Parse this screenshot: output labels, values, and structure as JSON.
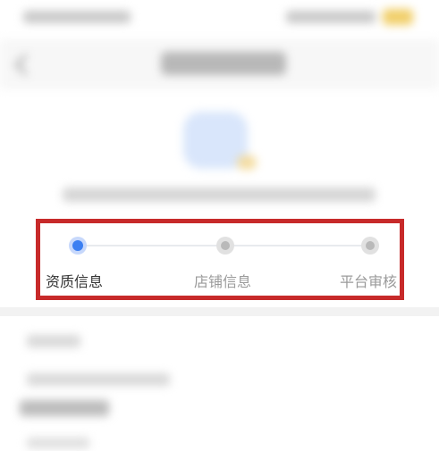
{
  "steps": [
    {
      "label": "资质信息",
      "state": "active"
    },
    {
      "label": "店铺信息",
      "state": "pending"
    },
    {
      "label": "平台审核",
      "state": "pending"
    }
  ],
  "colors": {
    "active_step": "#3b7ff2",
    "pending_step": "#b9b9b9",
    "highlight_border": "#c72a2a"
  },
  "icons": {
    "back": "chevron-left-icon"
  }
}
